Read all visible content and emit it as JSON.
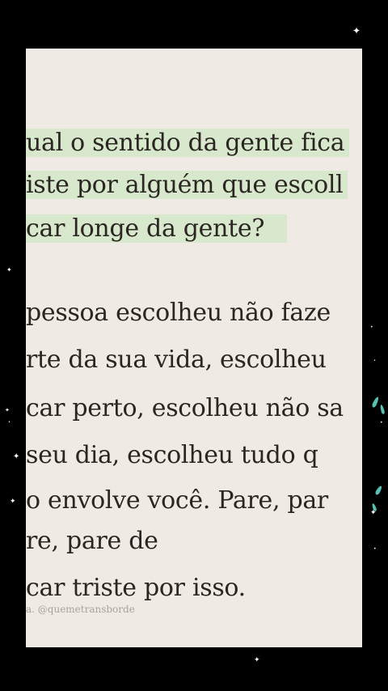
{
  "text": {
    "lines": [
      "ual o sentido da gente fica",
      "iste por alguém que escoll",
      "car longe da gente?",
      "pessoa escolheu não faze",
      "rte da sua vida, escolheu",
      "car perto, escolheu não sa",
      "seu dia, escolheu tudo q",
      "o envolve você. Pare, par",
      "re, pare de",
      "car triste por isso."
    ],
    "credit": "a. @quemetransborde"
  },
  "colors": {
    "background": "#000000",
    "paper": "#efeae4",
    "highlight": "#d7e8cc",
    "ink": "#2b2622",
    "accent": "#5fd6c4"
  },
  "decorations": {
    "sparkle_icon": "four-point-star-icon",
    "leaf_icon": "leaf-icon"
  }
}
